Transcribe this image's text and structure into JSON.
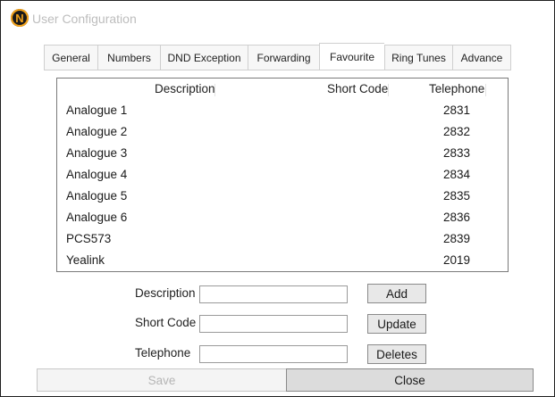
{
  "window": {
    "title": "User Configuration",
    "logo_letter": "N"
  },
  "tabs": [
    {
      "label": "General"
    },
    {
      "label": "Numbers"
    },
    {
      "label": "DND Exception"
    },
    {
      "label": "Forwarding"
    },
    {
      "label": "Favourite",
      "active": true
    },
    {
      "label": "Ring Tunes"
    },
    {
      "label": "Advance"
    }
  ],
  "favourites": {
    "columns": {
      "description": "Description",
      "short_code": "Short Code",
      "telephone": "Telephone"
    },
    "rows": [
      {
        "description": "Analogue 1",
        "short_code": "",
        "telephone": "2831"
      },
      {
        "description": "Analogue 2",
        "short_code": "",
        "telephone": "2832"
      },
      {
        "description": "Analogue 3",
        "short_code": "",
        "telephone": "2833"
      },
      {
        "description": "Analogue 4",
        "short_code": "",
        "telephone": "2834"
      },
      {
        "description": "Analogue 5",
        "short_code": "",
        "telephone": "2835"
      },
      {
        "description": "Analogue 6",
        "short_code": "",
        "telephone": "2836"
      },
      {
        "description": "PCS573",
        "short_code": "",
        "telephone": "2839"
      },
      {
        "description": "Yealink",
        "short_code": "",
        "telephone": "2019"
      }
    ]
  },
  "form": {
    "description_label": "Description",
    "description_value": "",
    "short_code_label": "Short Code",
    "short_code_value": "",
    "telephone_label": "Telephone",
    "telephone_value": "",
    "add_label": "Add",
    "update_label": "Update",
    "delete_label": "Deletes"
  },
  "footer": {
    "save_label": "Save",
    "close_label": "Close"
  },
  "colors": {
    "logo_ring": "#f2a21a",
    "logo_bg": "#1a1a1a",
    "disabled_text": "#b5b5b5"
  }
}
